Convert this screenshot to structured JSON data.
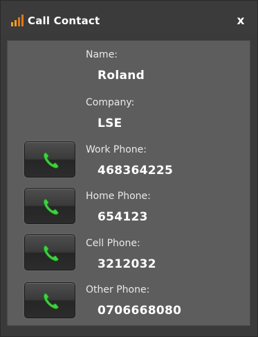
{
  "window": {
    "title": "Call Contact",
    "close_label": "x",
    "icon": "signal-bars-icon"
  },
  "contact": {
    "name_label": "Name:",
    "name": "Roland",
    "company_label": "Company:",
    "company": "LSE"
  },
  "phones": [
    {
      "label": "Work Phone:",
      "number": "468364225",
      "button_icon": "phone-icon"
    },
    {
      "label": "Home Phone:",
      "number": "654123",
      "button_icon": "phone-icon"
    },
    {
      "label": "Cell Phone:",
      "number": "3212032",
      "button_icon": "phone-icon"
    },
    {
      "label": "Other Phone:",
      "number": "0706668080",
      "button_icon": "phone-icon"
    }
  ],
  "colors": {
    "accent_orange": "#f0a020",
    "phone_green": "#3fd13f",
    "panel_gray": "#5d5d5d",
    "titlebar_dark": "#3b3b3b"
  }
}
